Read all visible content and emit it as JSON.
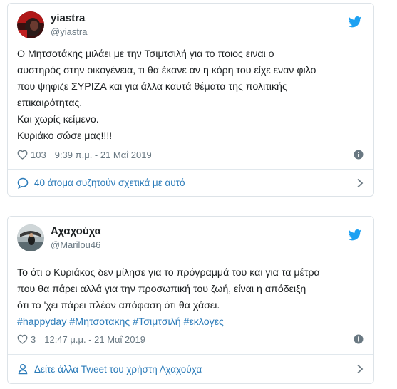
{
  "tweets": [
    {
      "name": "yiastra",
      "handle": "@yiastra",
      "body_lines": [
        "Ο Μητσοτάκης μιλάει με την Τσιμτσιλή για το ποιος ειναι ο",
        "αυστηρός στην οικογένεια, τι θα έκανε αν η κόρη του είχε εναν φιλο",
        "που ψηφιζε ΣΥΡΙΖΑ και για άλλα καυτά θέματα της πολιτικής",
        "επικαιρότητας.",
        "Και χωρίς κείμενο.",
        "Κυριάκο σώσε μας!!!!"
      ],
      "likes": "103",
      "timestamp": "9:39 π.μ. - 21 Μαΐ 2019",
      "footer_text": "40 άτομα συζητούν σχετικά με αυτό",
      "footer_icon": "chat-bubble-icon"
    },
    {
      "name": "Αχαχούχα",
      "handle": "@Marilou46",
      "body_lines": [
        "Το ότι ο Κυριάκος δεν μίλησε για το πρόγραμμά του και για τα μέτρα",
        "που θα πάρει αλλά για την προσωπική του ζωή, είναι η απόδειξη",
        "ότι το 'χει πάρει πλέον απόφαση ότι θα χάσει."
      ],
      "hashtags": [
        "#happyday",
        "#Μητσοτακης",
        "#Τσιμτσιλή",
        "#εκλογες"
      ],
      "likes": "3",
      "timestamp": "12:47 μ.μ. - 21 Μαΐ 2019",
      "footer_text": "Δείτε άλλα Tweet του χρήστη Αχαχούχα",
      "footer_icon": "person-icon"
    }
  ],
  "colors": {
    "twitter_blue": "#1da1f2",
    "link_blue": "#2b7bb9",
    "meta_gray": "#697882",
    "border": "#dde3e8"
  }
}
